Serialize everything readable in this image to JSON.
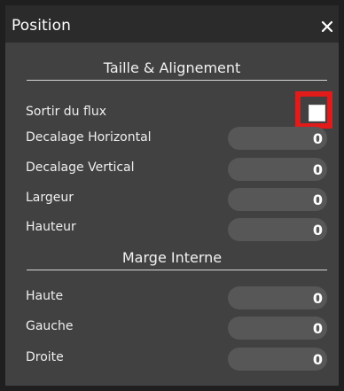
{
  "panel": {
    "title": "Position",
    "close_icon": "close-icon"
  },
  "sections": {
    "size_alignment": "Taille & Alignement",
    "inner_margin": "Marge Interne"
  },
  "fields": {
    "out_of_flow": {
      "label": "Sortir du flux",
      "checked": false
    },
    "offset_horizontal": {
      "label": "Decalage Horizontal",
      "value": "0"
    },
    "offset_vertical": {
      "label": "Decalage Vertical",
      "value": "0"
    },
    "width": {
      "label": "Largeur",
      "value": "0"
    },
    "height": {
      "label": "Hauteur",
      "value": "0"
    },
    "margin_top": {
      "label": "Haute",
      "value": "0"
    },
    "margin_left": {
      "label": "Gauche",
      "value": "0"
    },
    "margin_right": {
      "label": "Droite",
      "value": "0"
    }
  },
  "colors": {
    "highlight": "#e11a1a",
    "panel_bg": "#414141",
    "titlebar_bg": "#2b2b2b",
    "input_bg": "#575757"
  }
}
